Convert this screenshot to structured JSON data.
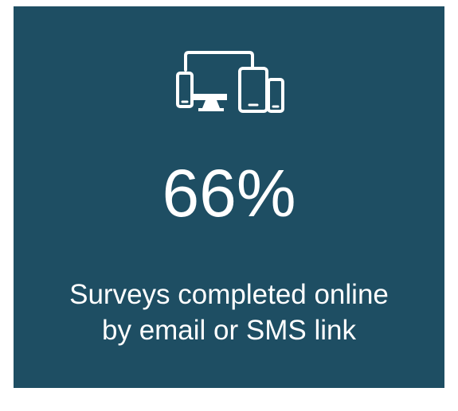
{
  "card": {
    "background_color": "#1e4e63",
    "text_color": "#ffffff",
    "icon": "multi-device-icon",
    "stat_value": "66%",
    "caption_line_1": "Surveys completed online",
    "caption_line_2": "by email or SMS link"
  }
}
